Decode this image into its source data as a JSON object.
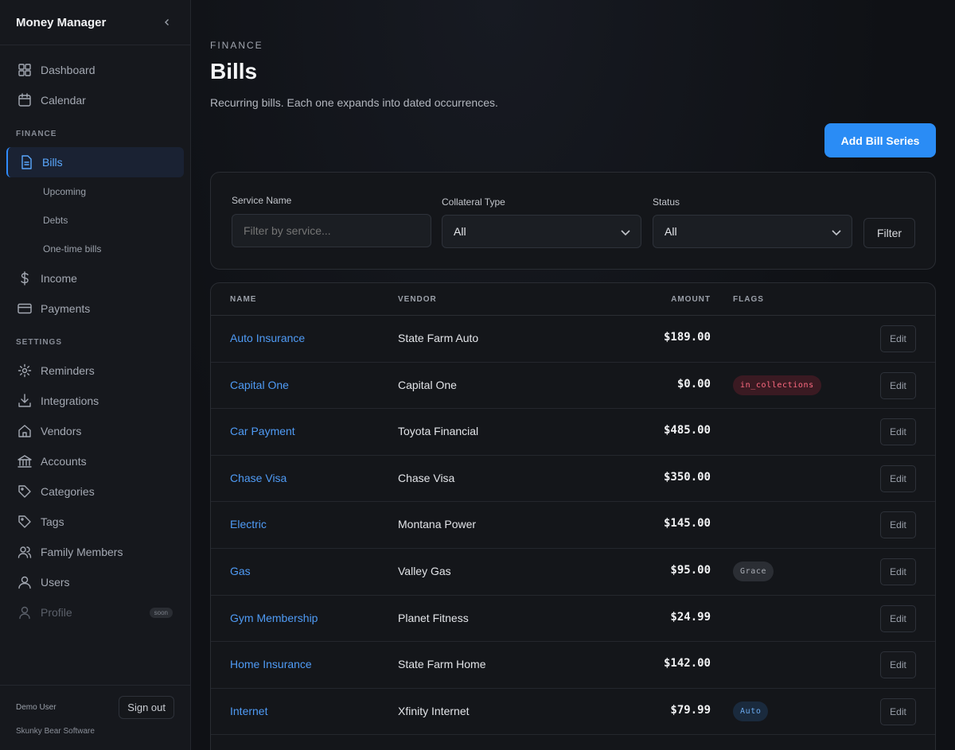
{
  "app": {
    "title": "Money Manager"
  },
  "sidebar": {
    "top_items": [
      {
        "label": "Dashboard",
        "icon": "dashboard-icon"
      },
      {
        "label": "Calendar",
        "icon": "calendar-icon"
      }
    ],
    "finance_label": "FINANCE",
    "finance_items": [
      {
        "label": "Bills",
        "icon": "document-icon",
        "active": true
      },
      {
        "label": "Upcoming"
      },
      {
        "label": "Debts"
      },
      {
        "label": "One-time bills"
      },
      {
        "label": "Income",
        "icon": "dollar-icon"
      },
      {
        "label": "Payments",
        "icon": "credit-card-icon"
      }
    ],
    "settings_label": "SETTINGS",
    "settings_items": [
      {
        "label": "Reminders",
        "icon": "gear-icon"
      },
      {
        "label": "Integrations",
        "icon": "download-icon"
      },
      {
        "label": "Vendors",
        "icon": "store-icon"
      },
      {
        "label": "Accounts",
        "icon": "bank-icon"
      },
      {
        "label": "Categories",
        "icon": "tag-icon"
      },
      {
        "label": "Tags",
        "icon": "tag-icon"
      },
      {
        "label": "Family Members",
        "icon": "users-icon"
      },
      {
        "label": "Users",
        "icon": "user-group-icon"
      },
      {
        "label": "Profile",
        "icon": "user-icon",
        "badge": "soon",
        "disabled": true
      }
    ],
    "footer": {
      "user": "Demo User",
      "sign_out": "Sign out",
      "company": "Skunky Bear Software"
    }
  },
  "page": {
    "eyebrow": "FINANCE",
    "title": "Bills",
    "subtitle": "Recurring bills. Each one expands into dated occurrences.",
    "add_button": "Add Bill Series"
  },
  "filters": {
    "service_label": "Service Name",
    "service_placeholder": "Filter by service...",
    "collateral_label": "Collateral Type",
    "collateral_value": "All",
    "status_label": "Status",
    "status_value": "All",
    "filter_button": "Filter"
  },
  "table": {
    "headers": {
      "name": "NAME",
      "vendor": "VENDOR",
      "amount": "AMOUNT",
      "flags": "FLAGS"
    },
    "edit_label": "Edit",
    "rows": [
      {
        "name": "Auto Insurance",
        "vendor": "State Farm Auto",
        "amount": "$189.00",
        "flag": ""
      },
      {
        "name": "Capital One",
        "vendor": "Capital One",
        "amount": "$0.00",
        "flag": "in_collections",
        "flag_style": "danger"
      },
      {
        "name": "Car Payment",
        "vendor": "Toyota Financial",
        "amount": "$485.00",
        "flag": ""
      },
      {
        "name": "Chase Visa",
        "vendor": "Chase Visa",
        "amount": "$350.00",
        "flag": ""
      },
      {
        "name": "Electric",
        "vendor": "Montana Power",
        "amount": "$145.00",
        "flag": ""
      },
      {
        "name": "Gas",
        "vendor": "Valley Gas",
        "amount": "$95.00",
        "flag": "Grace",
        "flag_style": "neutral"
      },
      {
        "name": "Gym Membership",
        "vendor": "Planet Fitness",
        "amount": "$24.99",
        "flag": ""
      },
      {
        "name": "Home Insurance",
        "vendor": "State Farm Home",
        "amount": "$142.00",
        "flag": ""
      },
      {
        "name": "Internet",
        "vendor": "Xfinity Internet",
        "amount": "$79.99",
        "flag": "Auto",
        "flag_style": "info"
      }
    ]
  },
  "colors": {
    "accent": "#2a8cf5",
    "link": "#4f9bf5",
    "danger_bg": "#3a1a22",
    "danger_fg": "#ff6b81"
  }
}
